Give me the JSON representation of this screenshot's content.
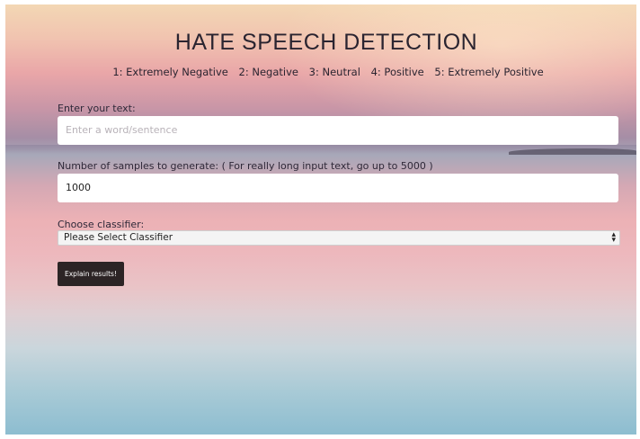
{
  "page": {
    "title": "HATE SPEECH DETECTION",
    "legend": [
      "1: Extremely Negative",
      "2: Negative",
      "3: Neutral",
      "4: Positive",
      "5: Extremely Positive"
    ]
  },
  "form": {
    "text_label": "Enter your text:",
    "text_placeholder": "Enter a word/sentence",
    "samples_label": "Number of samples to generate: ( For really long input text, go up to 5000 )",
    "samples_value": "1000",
    "classifier_label": "Choose classifier:",
    "classifier_selected": "Please Select Classifier",
    "submit_label": "Explain results!"
  },
  "colors": {
    "button_bg": "#2c2425",
    "text": "#2a2430"
  }
}
